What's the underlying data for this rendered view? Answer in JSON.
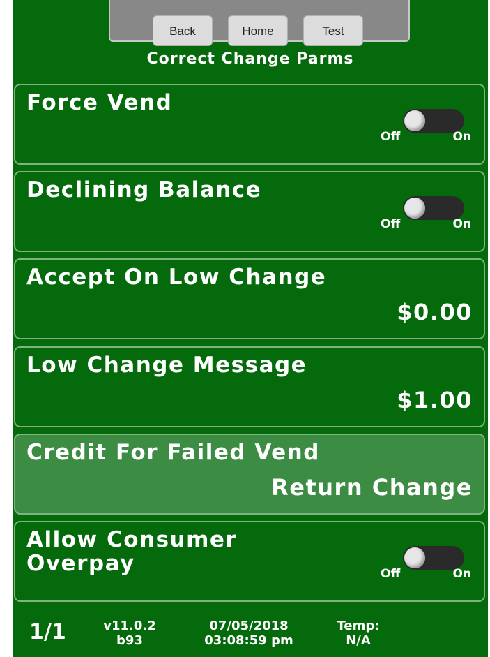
{
  "nav": {
    "back_label": "Back",
    "home_label": "Home",
    "test_label": "Test"
  },
  "screen_title": "Correct Change Parms",
  "settings": [
    {
      "label": "Force Vend",
      "type": "toggle",
      "state": "Off",
      "off_label": "Off",
      "on_label": "On"
    },
    {
      "label": "Declining Balance",
      "type": "toggle",
      "state": "Off",
      "off_label": "Off",
      "on_label": "On"
    },
    {
      "label": "Accept On Low Change",
      "type": "value",
      "value": "$0.00"
    },
    {
      "label": "Low Change Message",
      "type": "value",
      "value": "$1.00"
    },
    {
      "label": "Credit For Failed Vend",
      "type": "value",
      "value": "Return Change",
      "highlighted": true
    },
    {
      "label_line1": "Allow Consumer",
      "label_line2": "Overpay",
      "type": "toggle",
      "state": "Off",
      "off_label": "Off",
      "on_label": "On"
    }
  ],
  "footer": {
    "page": "1/1",
    "version": "v11.0.2",
    "build": "b93",
    "date": "07/05/2018",
    "time": "03:08:59 pm",
    "temp_label": "Temp:",
    "temp_value": "N/A"
  },
  "colors": {
    "background": "#046a0c",
    "highlight_row": "#3c8c44",
    "row_border": "#7fb37f",
    "toggle_track": "#2a2a2a",
    "toggle_knob": "#e6e6e6",
    "nav_bar": "#888888"
  }
}
